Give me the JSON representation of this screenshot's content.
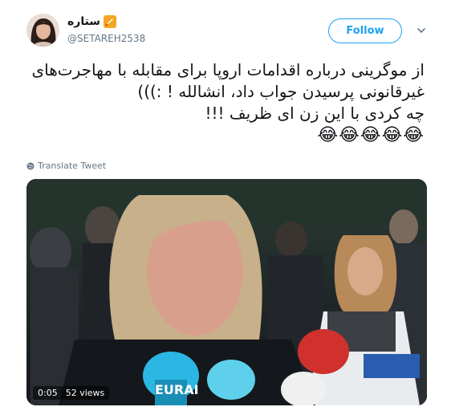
{
  "user": {
    "display_name": "ستاره",
    "handle": "@SETAREH2538",
    "avatar_icon": "profile-avatar",
    "badge_icon": "rocket-emoji-icon"
  },
  "actions": {
    "follow_label": "Follow",
    "more_icon": "chevron-down-icon"
  },
  "tweet": {
    "lines": [
      "از موگرینی درباره اقدامات اروپا برای مقابله با مهاجرت‌های",
      "غیرقانونی پرسیدن  جواب داد، انشالله ! :)))",
      "چه کردی با این زن ای ظریف !!!"
    ],
    "emojis": "😂😂😂😂😂"
  },
  "translate_label": "Translate Tweet",
  "video": {
    "time": "0:05",
    "views": "52 views",
    "mic_text": "EURAI"
  },
  "colors": {
    "accent": "#1da1f2",
    "muted": "#657786",
    "text": "#14171a"
  }
}
